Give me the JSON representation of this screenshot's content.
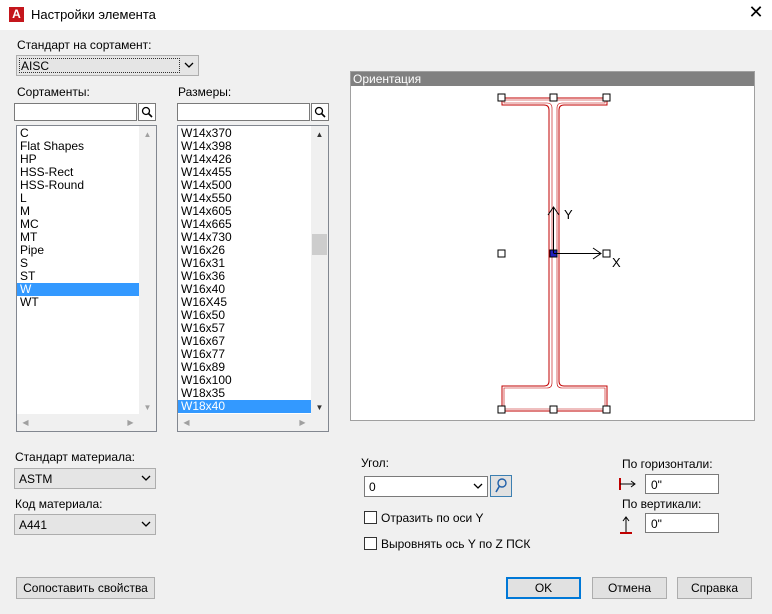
{
  "window": {
    "title": "Настройки элемента",
    "app_icon_letter": "A",
    "close_glyph": "✕"
  },
  "standard": {
    "label": "Стандарт на сортамент:",
    "value": "AISC"
  },
  "shapes": {
    "label": "Сортаменты:",
    "search_value": "",
    "items": [
      "C",
      "Flat Shapes",
      "HP",
      "HSS-Rect",
      "HSS-Round",
      "L",
      "M",
      "MC",
      "MT",
      "Pipe",
      "S",
      "ST",
      "W",
      "WT"
    ],
    "selected": "W"
  },
  "sizes": {
    "label": "Размеры:",
    "search_value": "",
    "items": [
      "W14x370",
      "W14x398",
      "W14x426",
      "W14x455",
      "W14x500",
      "W14x550",
      "W14x605",
      "W14x665",
      "W14x730",
      "W16x26",
      "W16x31",
      "W16x36",
      "W16x40",
      "W16X45",
      "W16x50",
      "W16x57",
      "W16x67",
      "W16x77",
      "W16x89",
      "W16x100",
      "W18x35",
      "W18x40"
    ],
    "selected": "W18x40"
  },
  "orientation": {
    "title": "Ориентация",
    "y_axis_label": "Y",
    "x_axis_label": "X"
  },
  "material_standard": {
    "label": "Стандарт материала:",
    "value": "ASTM"
  },
  "material_code": {
    "label": "Код материала:",
    "value": "A441"
  },
  "angle": {
    "label": "Угол:",
    "value": "0"
  },
  "mirror_y": {
    "label": "Отразить по оси Y",
    "checked": false
  },
  "align_y_ucs": {
    "label": "Выровнять ось Y по Z ПСК",
    "checked": false
  },
  "horizontal": {
    "label": "По горизонтали:",
    "value": "0\""
  },
  "vertical": {
    "label": "По вертикали:",
    "value": "0\""
  },
  "buttons": {
    "match_properties": "Сопоставить свойства",
    "ok": "OK",
    "cancel": "Отмена",
    "help": "Справка"
  },
  "colors": {
    "selection": "#3399ff",
    "profile_outline": "#c00000",
    "default_button_border": "#0078d7"
  }
}
